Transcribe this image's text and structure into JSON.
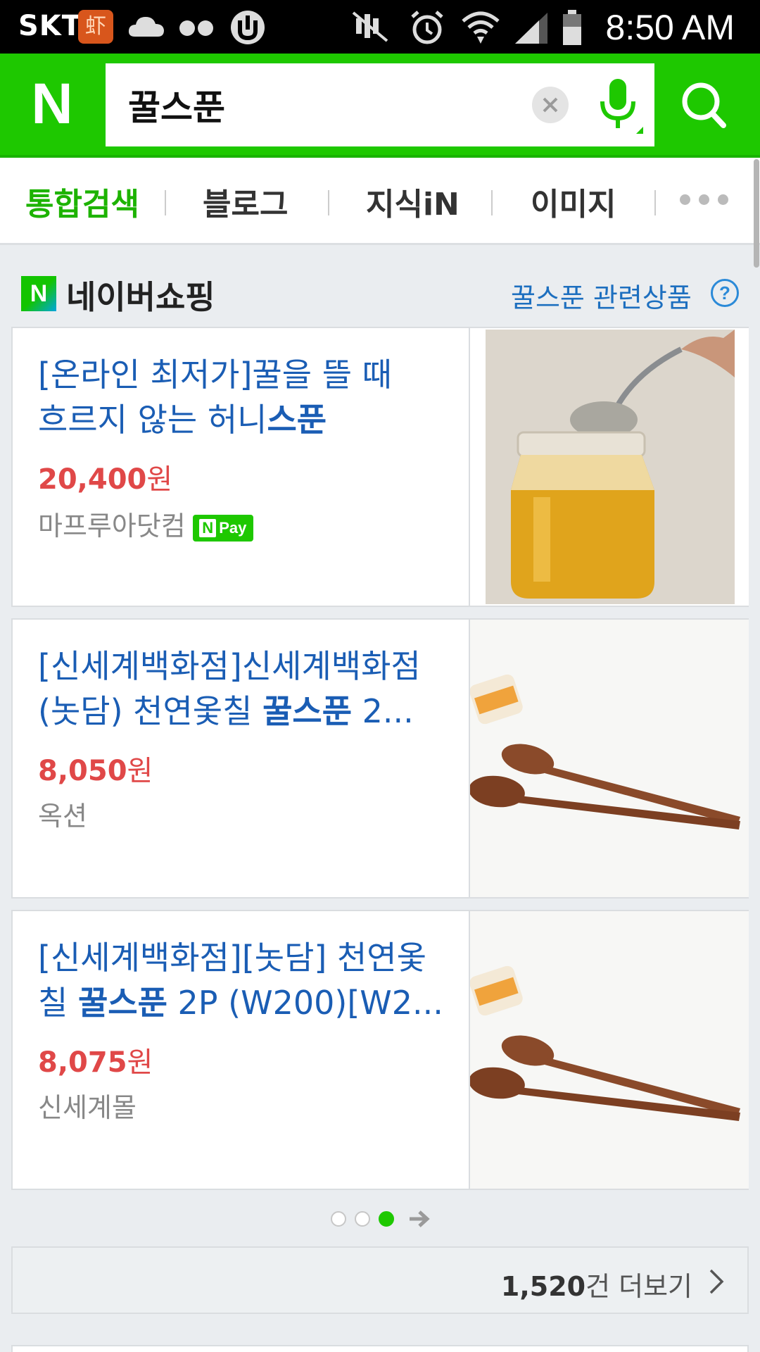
{
  "status_bar": {
    "carrier": "SKT",
    "app_icon_glyph": "虾",
    "time": "8:50 AM",
    "icons": [
      "cloud-icon",
      "dots-icon",
      "utorrent-icon",
      "mute-icon",
      "alarm-icon",
      "wifi-icon",
      "signal-icon",
      "battery-icon"
    ]
  },
  "header": {
    "logo": "N",
    "search_value": "꿀스푼",
    "accent": "#1ec800"
  },
  "tabs": [
    {
      "label": "통합검색",
      "active": true
    },
    {
      "label": "블로그",
      "active": false
    },
    {
      "label": "지식iN",
      "active": false
    },
    {
      "label": "이미지",
      "active": false
    }
  ],
  "shopping": {
    "logo": "N",
    "title": "네이버쇼핑",
    "related": "꿀스푼 관련상품",
    "help": "?",
    "products": [
      {
        "title_line1": "[온라인 최저가]꿀을 뜰 때",
        "title_line2_plain": "흐르지 않는 허니",
        "title_line2_bold": "스푼",
        "price": "20,400",
        "currency": "원",
        "seller": "마프루아닷컴",
        "badge_n": "N",
        "badge_pay": "Pay",
        "image": "honey-jar-spoon"
      },
      {
        "title_line1": "[신세계백화점]신세계백화점",
        "title_line2_plain": "(놋담) 천연옻칠 ",
        "title_line2_bold": "꿀스푼",
        "title_line2_tail": " 2...",
        "price": "8,050",
        "currency": "원",
        "seller": "옥션",
        "image": "wooden-spoons"
      },
      {
        "title_line1": "[신세계백화점][놋담] 천연옻",
        "title_line2_plain": "칠 ",
        "title_line2_bold": "꿀스푼",
        "title_line2_tail": " 2P (W200)[W2...",
        "price": "8,075",
        "currency": "원",
        "seller": "신세계몰",
        "image": "wooden-spoons"
      }
    ],
    "pager": {
      "pages": 3,
      "current": 3
    },
    "more": {
      "count": "1,520",
      "suffix": "건 더보기"
    },
    "price_color": "#e04848",
    "title_color": "#1a5db4"
  }
}
